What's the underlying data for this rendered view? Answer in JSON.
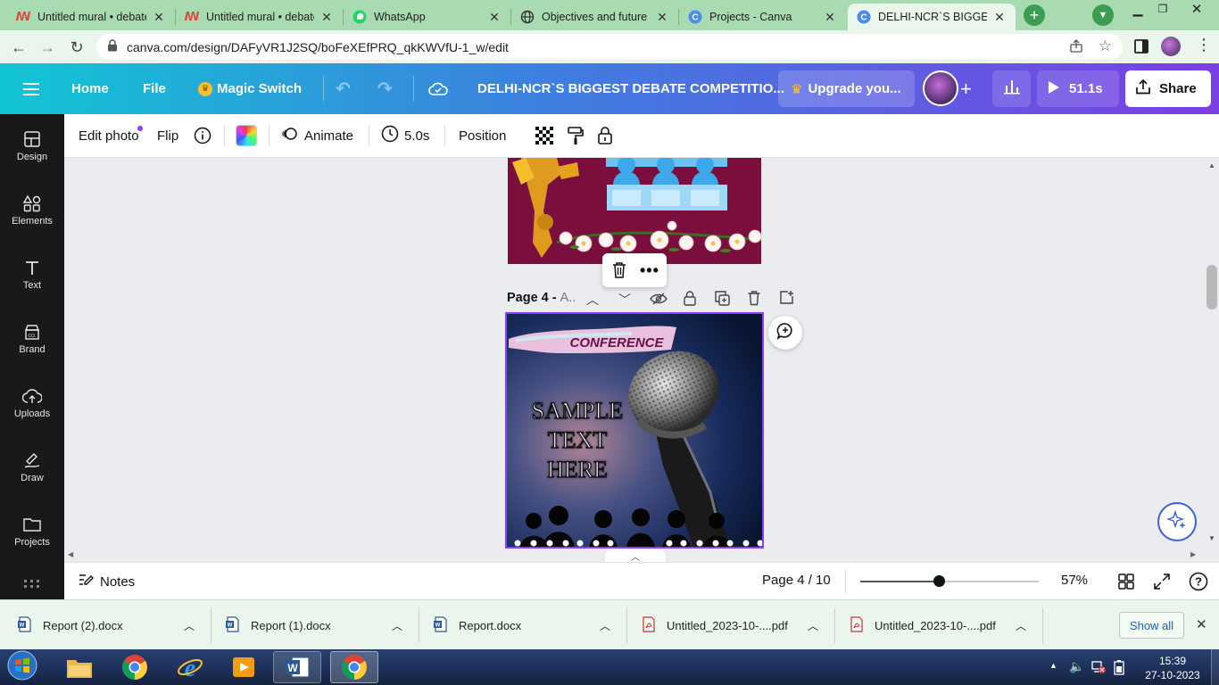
{
  "browser": {
    "tabs": [
      {
        "title": "Untitled mural • debate",
        "icon": "mural-icon"
      },
      {
        "title": "Untitled mural • debate",
        "icon": "mural-icon"
      },
      {
        "title": "WhatsApp",
        "icon": "whatsapp-icon"
      },
      {
        "title": "Objectives and future p",
        "icon": "globe-icon"
      },
      {
        "title": "Projects - Canva",
        "icon": "canva-icon"
      },
      {
        "title": "DELHI-NCR`S BIGGEST",
        "icon": "canva-icon"
      }
    ],
    "new_tab": "+",
    "url": "canva.com/design/DAFyVR1J2SQ/boFeXEfPRQ_qkKWVfU-1_w/edit"
  },
  "header": {
    "home": "Home",
    "file": "File",
    "magic_switch": "Magic Switch",
    "doc_title": "DELHI-NCR`S BIGGEST DEBATE COMPETITIO...",
    "upgrade": "Upgrade you...",
    "present_time": "51.1s",
    "share": "Share"
  },
  "sidebar": {
    "items": [
      {
        "label": "Design"
      },
      {
        "label": "Elements"
      },
      {
        "label": "Text"
      },
      {
        "label": "Brand"
      },
      {
        "label": "Uploads"
      },
      {
        "label": "Draw"
      },
      {
        "label": "Projects"
      }
    ]
  },
  "toolbar": {
    "edit_photo": "Edit photo",
    "flip": "Flip",
    "animate": "Animate",
    "duration": "5.0s",
    "position": "Position"
  },
  "canvas": {
    "page_label": "Page 4 - A...",
    "page_label_short": "Page 4 - A",
    "conference": "CONFERENCE",
    "sample_text": [
      "SAMPLE",
      "TEXT",
      "HERE"
    ]
  },
  "footer": {
    "notes": "Notes",
    "page_indicator": "Page 4 / 10",
    "zoom": "57%",
    "zoom_fraction": 0.44
  },
  "downloads": {
    "items": [
      {
        "name": "Report (2).docx",
        "type": "docx"
      },
      {
        "name": "Report (1).docx",
        "type": "docx"
      },
      {
        "name": "Report.docx",
        "type": "docx"
      },
      {
        "name": "Untitled_2023-10-....pdf",
        "type": "pdf"
      },
      {
        "name": "Untitled_2023-10-....pdf",
        "type": "pdf"
      }
    ],
    "show_all": "Show all"
  },
  "taskbar": {
    "time": "15:39",
    "date": "27-10-2023"
  },
  "colors": {
    "header_start": "#11c5d3",
    "header_end": "#7b3fe4",
    "browser_chrome": "#a8dbb1",
    "poster_bg": "#7a0f3d",
    "selection": "#8b3dff"
  }
}
